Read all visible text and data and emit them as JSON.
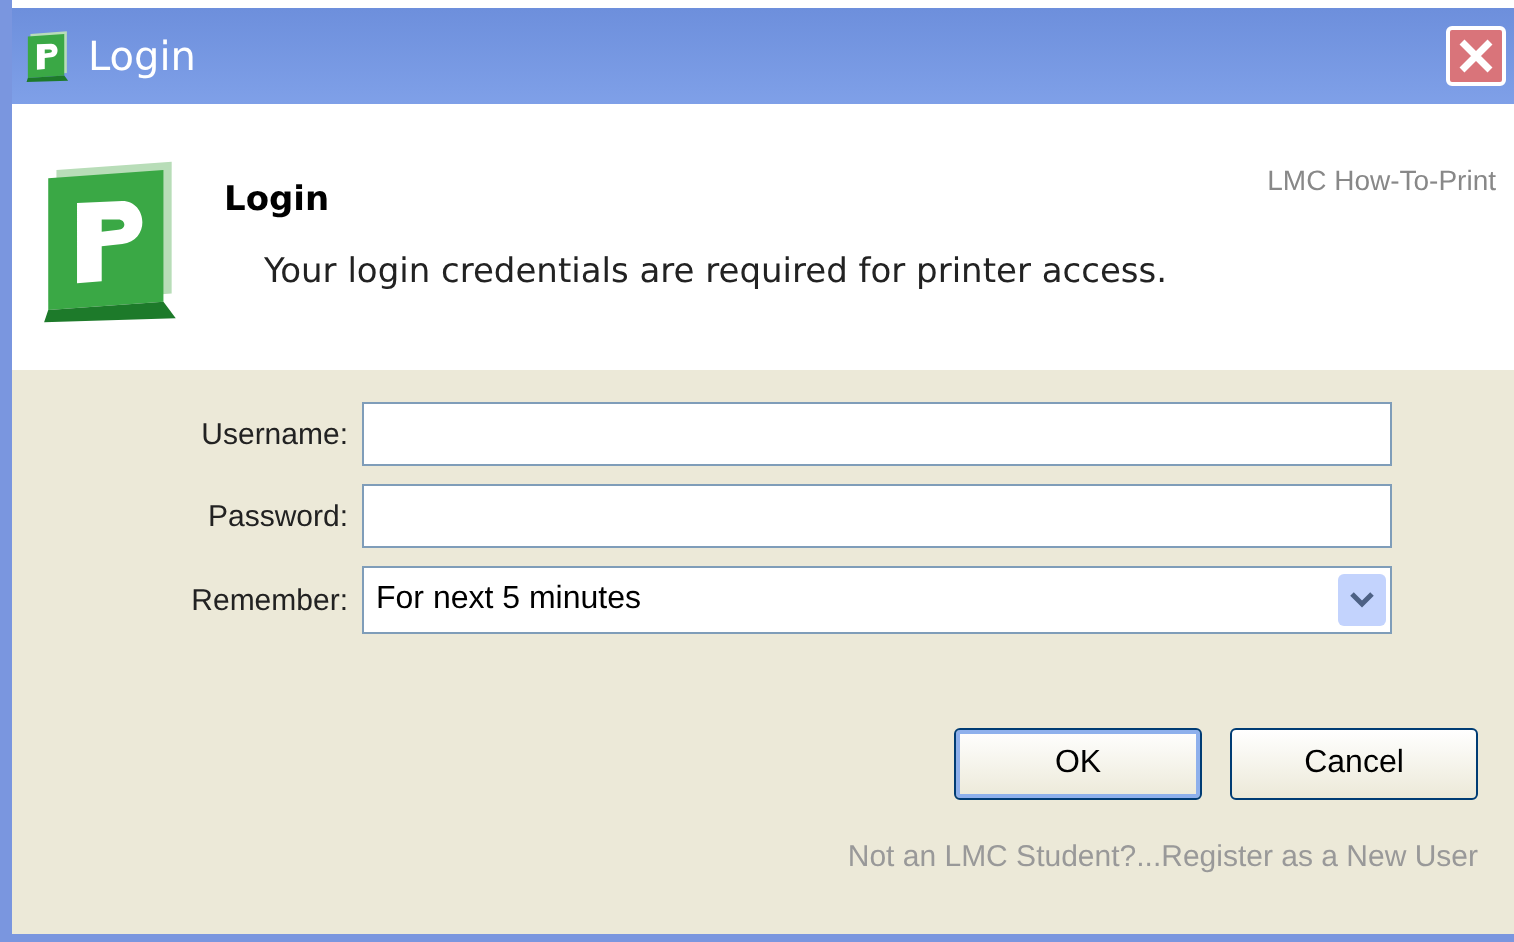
{
  "window": {
    "title": "Login"
  },
  "header": {
    "title": "Login",
    "subtitle": "Your login credentials are required for printer access.",
    "brand": "LMC How-To-Print"
  },
  "fields": [
    {
      "kind": "text",
      "label": "Username:"
    },
    {
      "kind": "password",
      "label": "Password:"
    },
    {
      "kind": "select",
      "label": "Remember:",
      "value": "For next 5 minutes"
    }
  ],
  "buttons": [
    {
      "label": "OK",
      "default": true
    },
    {
      "label": "Cancel",
      "default": false
    }
  ],
  "footer_link": "Not an LMC Student?...Register as a New User"
}
